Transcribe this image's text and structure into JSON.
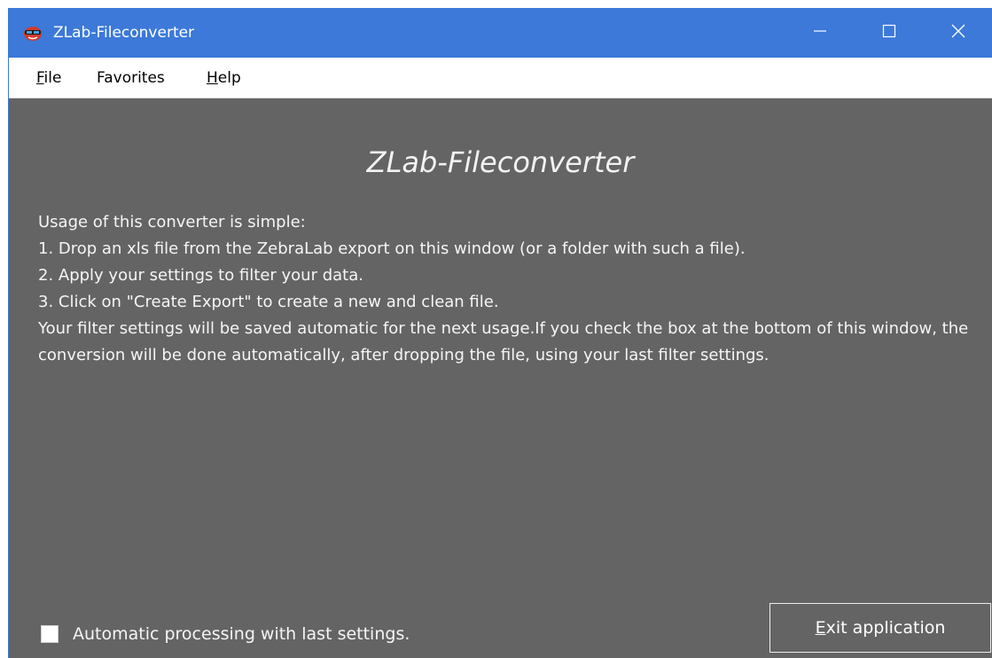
{
  "window": {
    "title": "ZLab-Fileconverter",
    "app_icon": "zlab-app-icon",
    "controls": {
      "minimize": "minimize-icon",
      "maximize": "maximize-icon",
      "close": "close-icon"
    }
  },
  "menu": {
    "items": [
      {
        "mnemonic": "F",
        "rest": "ile"
      },
      {
        "mnemonic": "",
        "rest": "Favorites"
      },
      {
        "mnemonic": "H",
        "rest": "elp"
      }
    ]
  },
  "content": {
    "heading": "ZLab-Fileconverter",
    "lines": [
      "Usage of this converter is simple:",
      "1. Drop an xls file from the ZebraLab export on this window (or a folder with such a file).",
      "2. Apply your settings to filter your data.",
      "3. Click on \"Create Export\" to create a new and clean file.",
      "Your filter settings will be saved automatic for the next usage.If you check the box at the bottom of this window, the conversion will be done automatically, after dropping the file, using your last filter settings."
    ],
    "auto_process": {
      "label": "Automatic processing with last settings.",
      "checked": false
    },
    "exit_button": {
      "mnemonic": "E",
      "rest": "xit application"
    }
  },
  "colors": {
    "titlebar": "#3c79d9",
    "content_bg": "#646464",
    "menu_bg": "#ffffff"
  }
}
